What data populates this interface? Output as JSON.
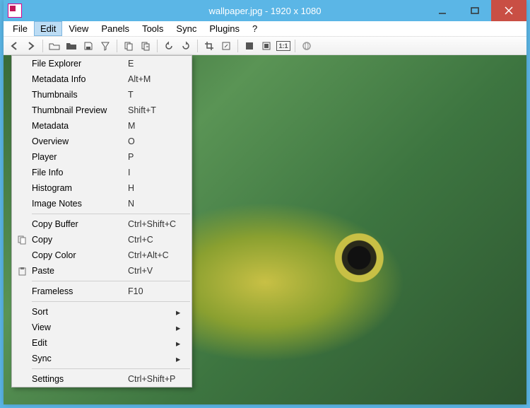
{
  "titlebar": {
    "title": "wallpaper.jpg  -  1920 x 1080"
  },
  "menubar": {
    "items": [
      {
        "label": "File"
      },
      {
        "label": "Edit",
        "active": true
      },
      {
        "label": "View"
      },
      {
        "label": "Panels"
      },
      {
        "label": "Tools"
      },
      {
        "label": "Sync"
      },
      {
        "label": "Plugins"
      },
      {
        "label": "?"
      }
    ]
  },
  "toolbar": {
    "buttons": [
      {
        "name": "prev-icon"
      },
      {
        "name": "next-icon"
      },
      {
        "sep": true
      },
      {
        "name": "folder-open-icon"
      },
      {
        "name": "folder-icon"
      },
      {
        "name": "save-icon"
      },
      {
        "name": "filter-icon"
      },
      {
        "sep": true
      },
      {
        "name": "copy-file-icon"
      },
      {
        "name": "move-file-icon"
      },
      {
        "sep": true
      },
      {
        "name": "rotate-ccw-icon"
      },
      {
        "name": "rotate-cw-icon"
      },
      {
        "sep": true
      },
      {
        "name": "crop-icon"
      },
      {
        "name": "resize-icon"
      },
      {
        "sep": true
      },
      {
        "name": "fullscreen-icon"
      },
      {
        "name": "fit-window-icon"
      },
      {
        "name": "actual-size-icon"
      },
      {
        "sep": true
      },
      {
        "name": "gps-icon"
      }
    ],
    "actual_size_label": "1:1"
  },
  "dropdown": {
    "groups": [
      [
        {
          "label": "File Explorer",
          "shortcut": "E"
        },
        {
          "label": "Metadata Info",
          "shortcut": "Alt+M"
        },
        {
          "label": "Thumbnails",
          "shortcut": "T"
        },
        {
          "label": "Thumbnail Preview",
          "shortcut": "Shift+T"
        },
        {
          "label": "Metadata",
          "shortcut": "M"
        },
        {
          "label": "Overview",
          "shortcut": "O"
        },
        {
          "label": "Player",
          "shortcut": "P"
        },
        {
          "label": "File Info",
          "shortcut": "I"
        },
        {
          "label": "Histogram",
          "shortcut": "H"
        },
        {
          "label": "Image Notes",
          "shortcut": "N"
        }
      ],
      [
        {
          "label": "Copy Buffer",
          "shortcut": "Ctrl+Shift+C"
        },
        {
          "label": "Copy",
          "shortcut": "Ctrl+C",
          "icon": "copy-icon"
        },
        {
          "label": "Copy Color",
          "shortcut": "Ctrl+Alt+C"
        },
        {
          "label": "Paste",
          "shortcut": "Ctrl+V",
          "icon": "paste-icon"
        }
      ],
      [
        {
          "label": "Frameless",
          "shortcut": "F10"
        }
      ],
      [
        {
          "label": "Sort",
          "submenu": true
        },
        {
          "label": "View",
          "submenu": true
        },
        {
          "label": "Edit",
          "submenu": true
        },
        {
          "label": "Sync",
          "submenu": true
        }
      ],
      [
        {
          "label": "Settings",
          "shortcut": "Ctrl+Shift+P"
        }
      ]
    ]
  }
}
